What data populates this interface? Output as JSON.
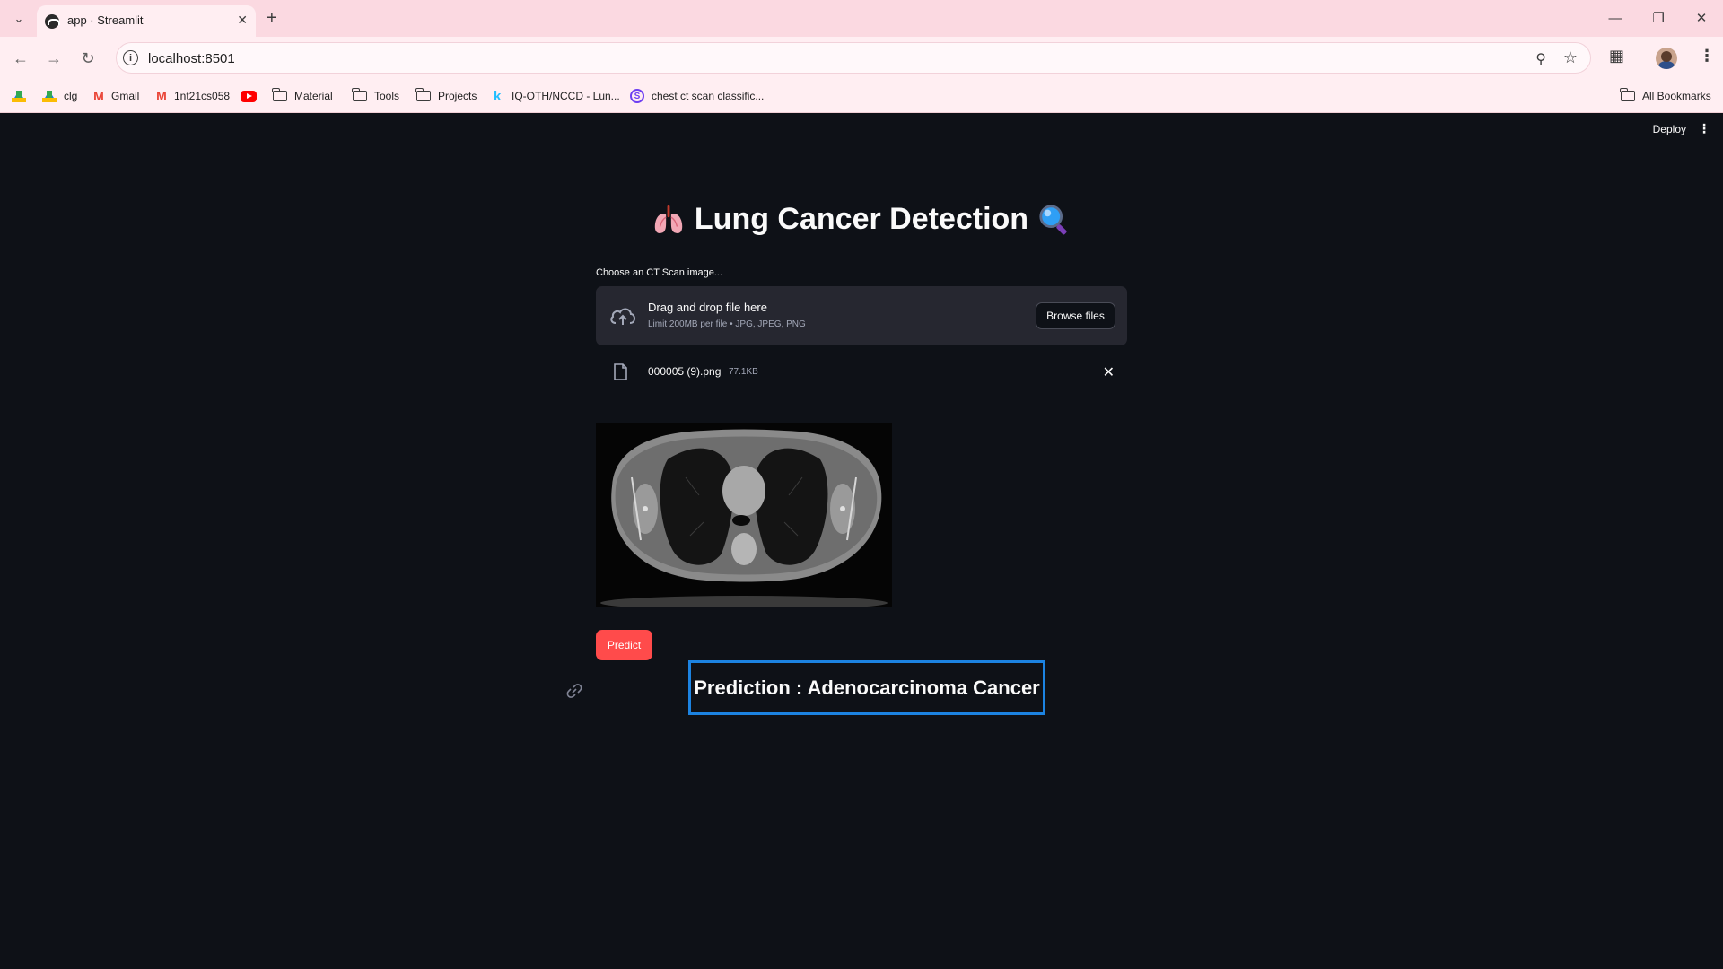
{
  "browser": {
    "tab_title": "app · Streamlit",
    "url": "localhost:8501",
    "bookmarks": [
      {
        "label": "",
        "icon": "drive-icon"
      },
      {
        "label": "clg",
        "icon": "drive-icon"
      },
      {
        "label": "Gmail",
        "icon": "gmail-icon"
      },
      {
        "label": "1nt21cs058",
        "icon": "gmail-icon"
      },
      {
        "label": "",
        "icon": "youtube-icon"
      },
      {
        "label": "Material",
        "icon": "folder-icon"
      },
      {
        "label": "Tools",
        "icon": "folder-icon"
      },
      {
        "label": "Projects",
        "icon": "folder-icon"
      },
      {
        "label": "IQ-OTH/NCCD - Lun...",
        "icon": "kaggle-icon"
      },
      {
        "label": "chest ct scan classific...",
        "icon": "streamlit-icon"
      }
    ],
    "all_bookmarks": "All Bookmarks"
  },
  "app": {
    "deploy_label": "Deploy",
    "title": "Lung Cancer Detection",
    "uploader": {
      "label": "Choose an CT Scan image...",
      "drag_text": "Drag and drop file here",
      "limit_text": "Limit 200MB per file • JPG, JPEG, PNG",
      "browse_label": "Browse files"
    },
    "file": {
      "name": "000005 (9).png",
      "size": "77.1KB"
    },
    "predict_label": "Predict",
    "prediction": "Prediction : Adenocarcinoma Cancer"
  },
  "colors": {
    "background": "#0e1117",
    "primary": "#ff4b4b",
    "highlight_border": "#1c83e1"
  }
}
